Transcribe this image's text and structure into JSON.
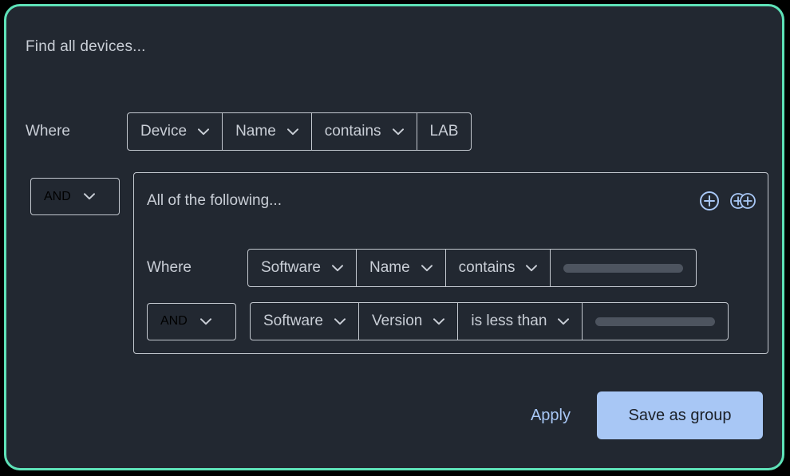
{
  "panel": {
    "title": "Find all devices...",
    "accent_border_color": "#5EE2B8",
    "background_color": "#222831"
  },
  "primary_condition": {
    "where_label": "Where",
    "segments": [
      {
        "value": "Device",
        "has_chevron": true
      },
      {
        "value": "Name",
        "has_chevron": true
      },
      {
        "value": "contains",
        "has_chevron": true
      },
      {
        "value": "LAB",
        "has_chevron": false
      }
    ]
  },
  "group": {
    "conjunction": "AND",
    "title": "All of the following...",
    "actions": {
      "add_condition_icon": "circle-plus-icon",
      "add_group_icon": "double-circle-plus-icon",
      "icon_color": "#A8C7F5"
    },
    "rows": [
      {
        "prefix_label": "Where",
        "prefix_type": "label",
        "segments": [
          {
            "value": "Software",
            "has_chevron": true
          },
          {
            "value": "Name",
            "has_chevron": true
          },
          {
            "value": "contains",
            "has_chevron": true
          }
        ],
        "value_field": {
          "type": "placeholder-bar",
          "value": ""
        }
      },
      {
        "prefix_label": "AND",
        "prefix_type": "dropdown",
        "segments": [
          {
            "value": "Software",
            "has_chevron": true
          },
          {
            "value": "Version",
            "has_chevron": true
          },
          {
            "value": "is less than",
            "has_chevron": true
          }
        ],
        "value_field": {
          "type": "placeholder-bar",
          "value": ""
        }
      }
    ]
  },
  "footer": {
    "apply_label": "Apply",
    "save_label": "Save as group",
    "save_background": "#A8C7F5",
    "apply_color": "#A8C7F5"
  }
}
